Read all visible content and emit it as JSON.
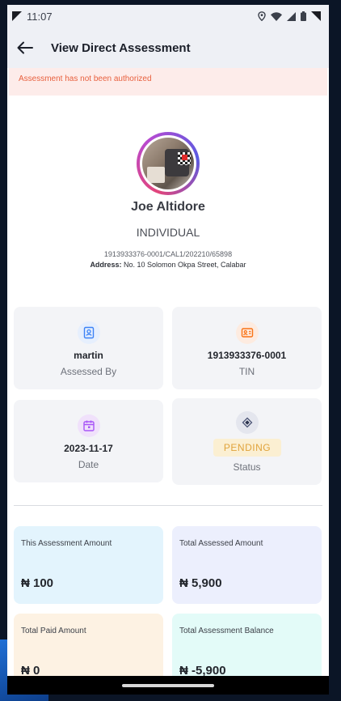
{
  "status_bar": {
    "time": "11:07"
  },
  "header": {
    "title": "View Direct Assessment"
  },
  "alert": {
    "message": "Assessment has not been authorized"
  },
  "profile": {
    "name": "Joe Altidore",
    "type": "INDIVIDUAL",
    "reference": "1913933376-0001/CAL1/202210/65898",
    "address_label": "Address:",
    "address_value": "No. 10 Solomon Okpa Street, Calabar"
  },
  "info_cards": {
    "assessed_by": {
      "value": "martin",
      "label": "Assessed By",
      "icon": "id-badge-icon",
      "color": "#3b82f6"
    },
    "tin": {
      "value": "1913933376-0001",
      "label": "TIN",
      "icon": "contact-card-icon",
      "color": "#f97316"
    },
    "date": {
      "value": "2023-11-17",
      "label": "Date",
      "icon": "calendar-icon",
      "color": "#a855f7"
    },
    "status": {
      "value": "PENDING",
      "label": "Status",
      "icon": "diamond-icon",
      "color": "#4b5475"
    }
  },
  "amounts": {
    "this_assessment": {
      "label": "This Assessment Amount",
      "value": "₦ 100",
      "bg": "#e3f4fd"
    },
    "total_assessed": {
      "label": "Total Assessed Amount",
      "value": "₦ 5,900",
      "bg": "#eceffd"
    },
    "total_paid": {
      "label": "Total Paid Amount",
      "value": "₦ 0",
      "bg": "#fdf2e3"
    },
    "total_balance": {
      "label": "Total Assessment Balance",
      "value": "₦ -5,900",
      "bg": "#e3fbf8"
    }
  }
}
